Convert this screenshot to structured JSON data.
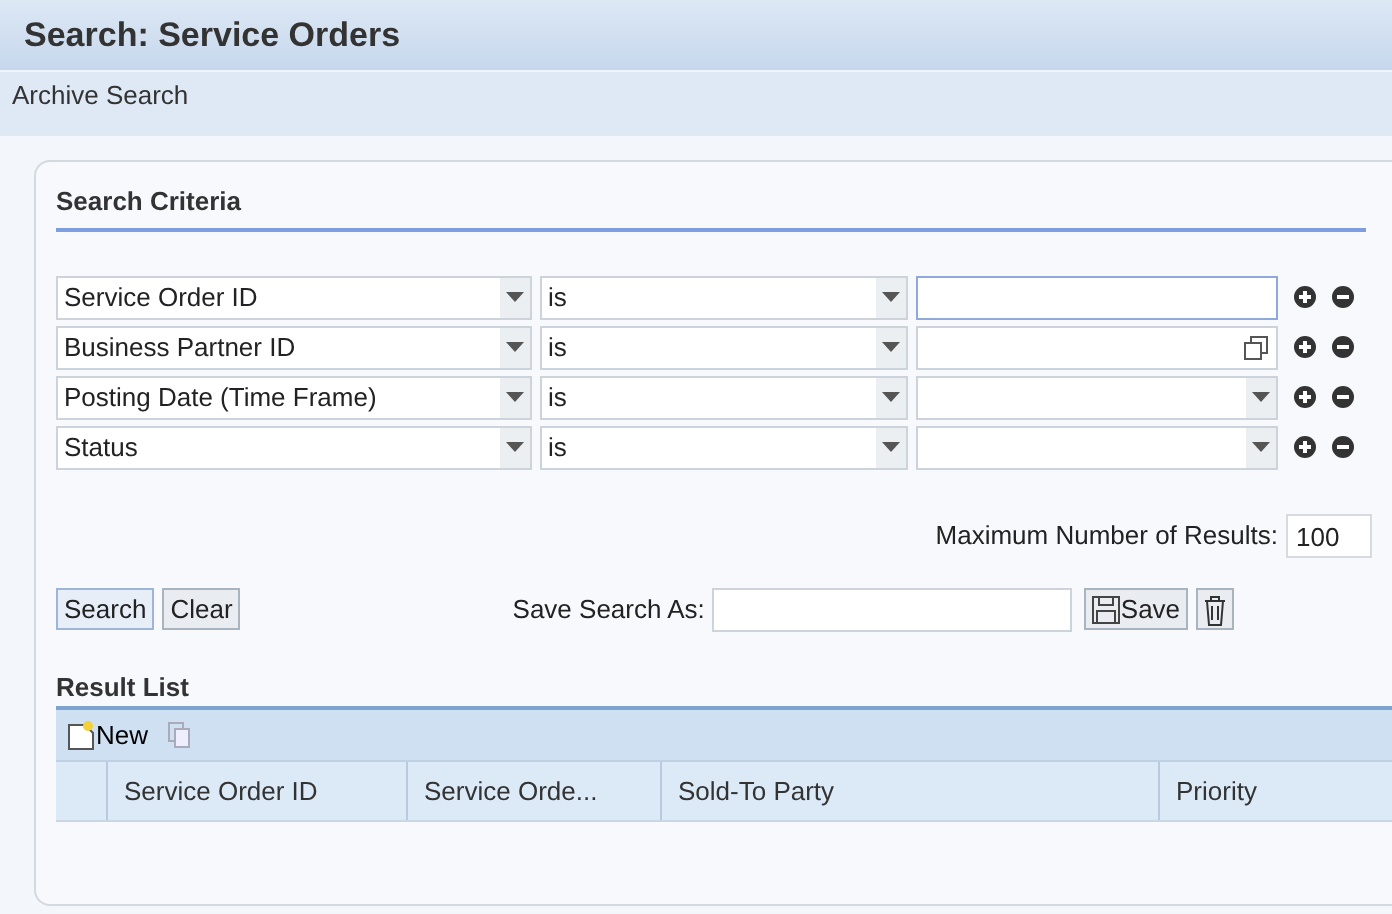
{
  "title": "Search: Service Orders",
  "subtitle": "Archive Search",
  "criteria": {
    "heading": "Search Criteria",
    "rows": [
      {
        "field": "Service Order ID",
        "operator": "is",
        "kind": "text",
        "focused": true
      },
      {
        "field": "Business Partner ID",
        "operator": "is",
        "kind": "help",
        "focused": false
      },
      {
        "field": "Posting Date (Time Frame)",
        "operator": "is",
        "kind": "dropdown",
        "focused": false
      },
      {
        "field": "Status",
        "operator": "is",
        "kind": "dropdown",
        "focused": false
      }
    ],
    "max_results_label": "Maximum Number of Results:",
    "max_results": "100",
    "buttons": [
      "Search",
      "Clear"
    ],
    "save_label": "Save Search As:",
    "save_button": "Save"
  },
  "results": {
    "heading": "Result List",
    "new_button": "New",
    "columns": [
      "Service Order ID",
      "Service Orde...",
      "Sold-To Party",
      "Priority"
    ]
  }
}
